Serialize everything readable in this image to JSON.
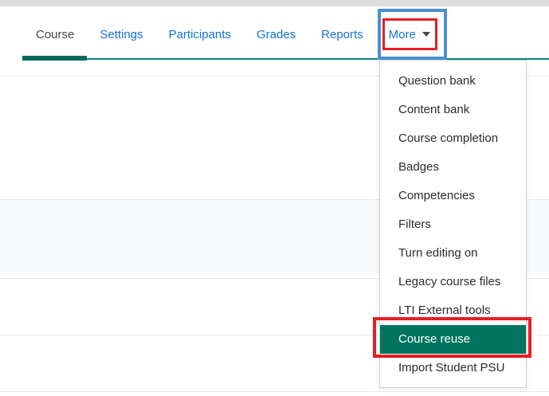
{
  "tabs": {
    "items": [
      {
        "label": "Course",
        "active": true,
        "has_caret": false
      },
      {
        "label": "Settings",
        "active": false,
        "has_caret": false
      },
      {
        "label": "Participants",
        "active": false,
        "has_caret": false
      },
      {
        "label": "Grades",
        "active": false,
        "has_caret": false
      },
      {
        "label": "Reports",
        "active": false,
        "has_caret": false
      },
      {
        "label": "More",
        "active": false,
        "has_caret": true
      }
    ]
  },
  "dropdown": {
    "items": [
      {
        "label": "Question bank",
        "highlighted": false
      },
      {
        "label": "Content bank",
        "highlighted": false
      },
      {
        "label": "Course completion",
        "highlighted": false
      },
      {
        "label": "Badges",
        "highlighted": false
      },
      {
        "label": "Competencies",
        "highlighted": false
      },
      {
        "label": "Filters",
        "highlighted": false
      },
      {
        "label": "Turn editing on",
        "highlighted": false
      },
      {
        "label": "Legacy course files",
        "highlighted": false
      },
      {
        "label": "LTI External tools",
        "highlighted": false
      },
      {
        "label": "Course reuse",
        "highlighted": true
      },
      {
        "label": "Import Student PSU",
        "highlighted": false
      }
    ]
  },
  "annotations": {
    "red_box_color": "#e61e25",
    "focus_outline_color": "#4a90d2",
    "annotated_tab": "More",
    "annotated_menu_item": "Course reuse"
  },
  "colors": {
    "link_blue": "#1673cf",
    "active_tab_text": "#45484d",
    "active_tab_underline": "#066a5b",
    "tab_bar_line": "#0e8280",
    "menu_highlight_background": "#00745f",
    "menu_highlight_text": "#ffffff"
  }
}
